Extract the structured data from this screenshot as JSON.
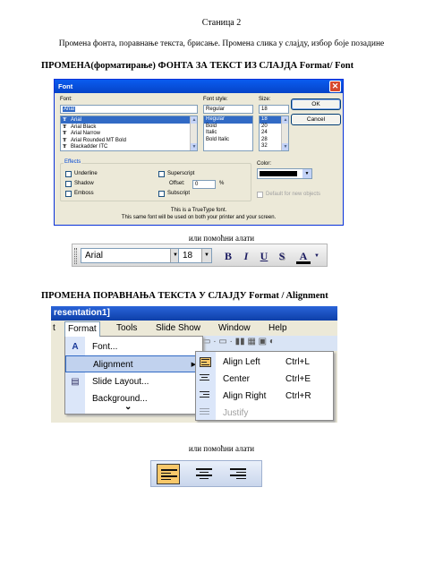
{
  "page_number": "Станица 2",
  "intro": "Промена фонта, поравнање текста, брисање. Промена слика у слајду, избор боје позадине",
  "heading_font": "ПРОМЕНА(форматирање) ФОНТА ЗА ТЕКСТ ИЗ СЛАЈДА  Format/ Font",
  "caption_tools_1": "или помоћни алати",
  "heading_align": "ПРОМЕНА ПОРАВНАЊА ТЕКСТА У СЛАЈДУ  Format / Alignment",
  "caption_tools_2": "или помоћни алати",
  "font_dialog": {
    "title": "Font",
    "close_glyph": "✕",
    "font_label": "Font:",
    "font_value": "Arial",
    "fonts": [
      "Arial",
      "Arial Black",
      "Arial Narrow",
      "Arial Rounded MT Bold",
      "Blackadder ITC"
    ],
    "tt_glyph": "Ŧ",
    "style_label": "Font style:",
    "style_value": "Regular",
    "styles": [
      "Regular",
      "Bold",
      "Italic",
      "Bold Italic"
    ],
    "size_label": "Size:",
    "size_value": "18",
    "sizes": [
      "18",
      "20",
      "24",
      "28",
      "32"
    ],
    "ok_label": "OK",
    "cancel_label": "Cancel",
    "effects_label": "Effects",
    "underline": "Underline",
    "shadow": "Shadow",
    "emboss": "Emboss",
    "superscript": "Superscript",
    "offset_label": "Offset:",
    "offset_value": "0",
    "offset_unit": "%",
    "subscript": "Subscript",
    "color_label": "Color:",
    "default_label": "Default for new objects",
    "info_1": "This is a TrueType font.",
    "info_2": "This same font will be used on both your printer and your screen.",
    "colors": {
      "accent": "#0a5cf0",
      "selection": "#316ac5",
      "font_color": "#000000"
    }
  },
  "font_toolbar": {
    "font": "Arial",
    "size": "18",
    "bold": "B",
    "italic": "I",
    "underline": "U",
    "shadow": "S",
    "font_color": "A"
  },
  "menu_shot": {
    "title": "resentation1]",
    "menubar": [
      "t",
      "Format",
      "Tools",
      "Slide Show",
      "Window",
      "Help"
    ],
    "format_menu": [
      {
        "icon": "A",
        "label": "Font..."
      },
      {
        "icon": "",
        "label": "Alignment",
        "arrow": "▶"
      },
      {
        "icon": "▤",
        "label": "Slide Layout..."
      },
      {
        "icon": "",
        "label": "Background..."
      }
    ],
    "more_glyph": "⌄",
    "align_menu": [
      {
        "label": "Align Left",
        "key": "Ctrl+L"
      },
      {
        "label": "Center",
        "key": "Ctrl+E"
      },
      {
        "label": "Align Right",
        "key": "Ctrl+R"
      },
      {
        "label": "Justify",
        "key": ""
      }
    ],
    "toolbar_glyphs": "▭ · ▭ · ▮▮ ▦ ▣ ◐"
  },
  "dropdown_glyph": "▼"
}
